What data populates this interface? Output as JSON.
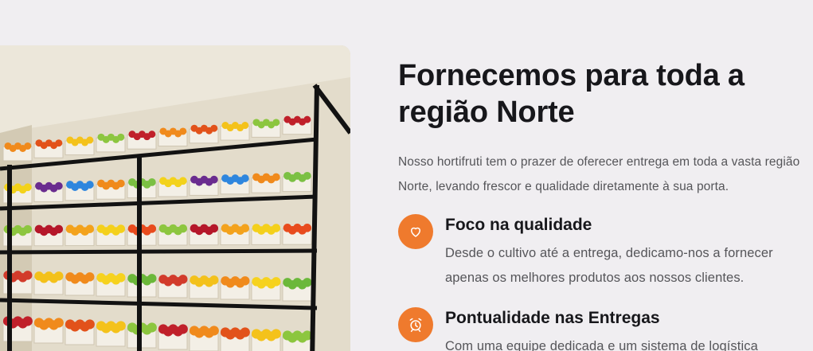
{
  "section": {
    "title": "Fornecemos para toda a região Norte",
    "intro": "Nosso hortifruti tem o prazer de oferecer entrega em toda a vasta região Norte, levando frescor e qualidade diretamente à sua porta.",
    "features": [
      {
        "icon": "heart-icon",
        "title": "Foco na qualidade",
        "text": "Desde o cultivo até a entrega, dedicamo-nos a fornecer apenas os melhores produtos aos nossos clientes."
      },
      {
        "icon": "alarm-clock-icon",
        "title": "Pontualidade nas Entregas",
        "text": "Com uma equipe dedicada e um sistema de logística"
      }
    ]
  },
  "image": {
    "subject": "produce-shelf-photo"
  },
  "colors": {
    "accent": "#ef7a2d",
    "background": "#f0eef1",
    "heading": "#17171b",
    "body_text": "#555559"
  }
}
